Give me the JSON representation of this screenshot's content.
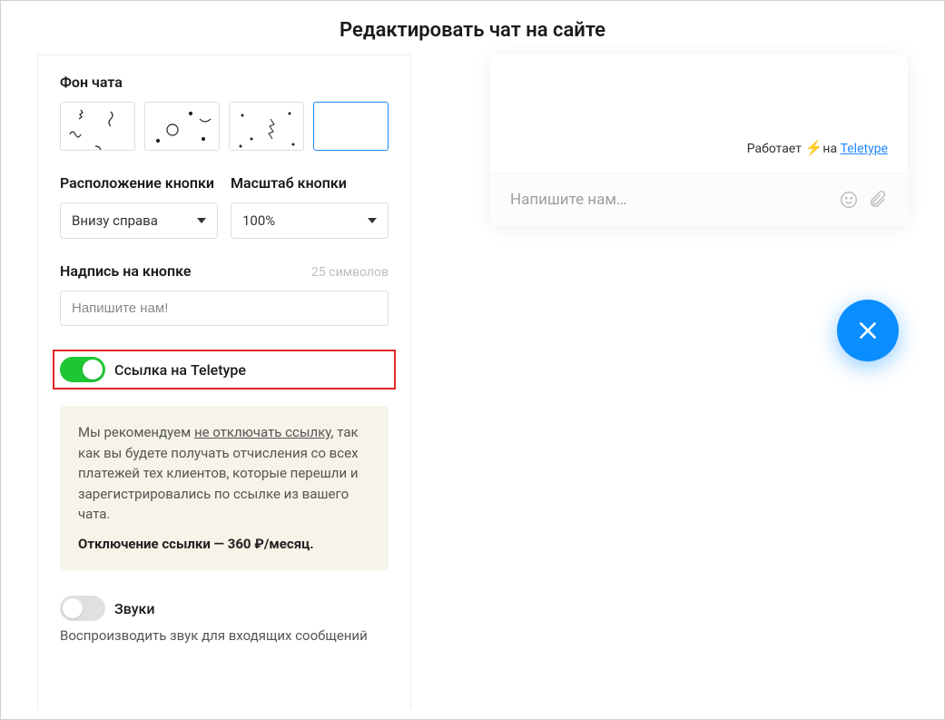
{
  "title": "Редактировать чат на сайте",
  "left": {
    "bg_label": "Фон чата",
    "position_label": "Расположение кнопки",
    "position_value": "Внизу справа",
    "scale_label": "Масштаб кнопки",
    "scale_value": "100%",
    "button_text_label": "Надпись на кнопке",
    "button_text_chars": "25 символов",
    "button_text_value": "Напишите нам!",
    "teletype_toggle_label": "Ссылка на Teletype",
    "info_text_prefix": "Мы рекомендуем ",
    "info_text_underline": "не отключать ссылку",
    "info_text_suffix": ", так как вы будете получать отчисления со всех платежей тех клиентов, которые перешли и зарегистрировались по ссылке из вашего чата.",
    "info_bold": "Отключение ссылки — 360 ₽/месяц.",
    "sounds_label": "Звуки",
    "sounds_desc": "Воспроизводить звук для входящих сообщений"
  },
  "preview": {
    "powered_prefix": "Работает ",
    "powered_mid": "на ",
    "powered_link": "Teletype",
    "input_placeholder": "Напишите нам…"
  }
}
